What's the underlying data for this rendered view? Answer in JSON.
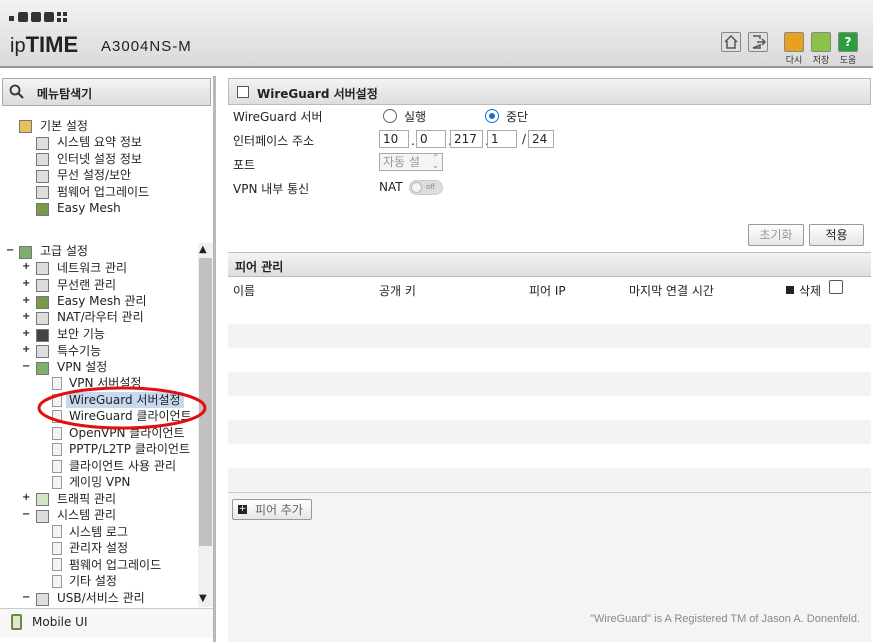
{
  "header": {
    "brand_prefix": "ip",
    "brand_bold": "TIME",
    "model": "A3004NS-M",
    "buttons": [
      {
        "icon": "home-icon",
        "label": ""
      },
      {
        "icon": "logout-icon",
        "label": ""
      },
      {
        "icon": "refresh-icon",
        "label": "다시",
        "color": "#e8a020"
      },
      {
        "icon": "save-icon",
        "label": "저장",
        "color": "#8bc34a"
      },
      {
        "icon": "help-icon",
        "label": "도움",
        "color": "#2e9e3c"
      }
    ]
  },
  "sidebar": {
    "title": "메뉴탐색기",
    "basic": {
      "label": "기본 설정",
      "items": [
        "시스템 요약 정보",
        "인터넷 설정 정보",
        "무선 설정/보안",
        "펌웨어 업그레이드",
        "Easy Mesh"
      ]
    },
    "advanced": {
      "label": "고급 설정",
      "groups": [
        "네트워크 관리",
        "무선랜 관리",
        "Easy Mesh 관리",
        "NAT/라우터 관리",
        "보안 기능",
        "특수기능"
      ],
      "vpn": {
        "label": "VPN 설정",
        "items": [
          "VPN 서버설정",
          "WireGuard 서버설정",
          "WireGuard 클라이언트",
          "OpenVPN 클라이언트",
          "PPTP/L2TP 클라이언트",
          "클라이언트 사용 관리",
          "게이밍 VPN"
        ]
      },
      "traffic": "트래픽 관리",
      "system": {
        "label": "시스템 관리",
        "items": [
          "시스템 로그",
          "관리자 설정",
          "펌웨어 업그레이드",
          "기타 설정"
        ]
      },
      "usb": "USB/서비스 관리"
    },
    "mobile": "Mobile UI"
  },
  "server": {
    "title": "WireGuard 서버설정",
    "server_label": "WireGuard 서버",
    "run_label": "실행",
    "stop_label": "중단",
    "iface_label": "인터페이스 주소",
    "ip": [
      "10",
      "0",
      "217",
      "1"
    ],
    "mask": "24",
    "port_label": "포트",
    "port_value": "자동 설",
    "vpn_comm_label": "VPN 내부 통신",
    "nat_label": "NAT",
    "toggle_text": "off",
    "reset": "초기화",
    "apply": "적용"
  },
  "peers": {
    "title": "피어 관리",
    "columns": [
      "이름",
      "공개 키",
      "피어 IP",
      "마지막 연결 시간"
    ],
    "delete_label": "삭제",
    "add": "피어 추가",
    "footer": "\"WireGuard\" is A Registered TM of Jason A. Donenfeld."
  },
  "annotation_color": "#e01010"
}
